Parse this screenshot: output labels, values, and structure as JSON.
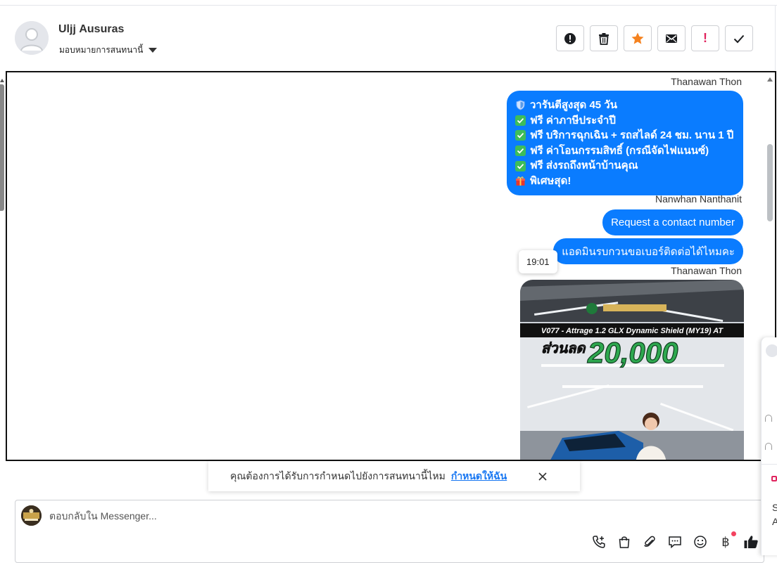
{
  "header": {
    "contact_name": "Ulјј Ausuras",
    "assign_label": "มอบหมายการสนทนานี้"
  },
  "chat": {
    "sender_1": "Thanawan Thon",
    "info_lines": [
      "วารันตีสูงสุด 45 วัน",
      "ฟรี ค่าภาษีประจำปี",
      "ฟรี บริการฉุกเฉิน + รถสไลด์ 24 ชม. นาน 1 ปี",
      "ฟรี ค่าโอนกรรมสิทธิ์ (กรณีจัดไฟแนนซ์)",
      "ฟรี ส่งรถถึงหน้าบ้านคุณ",
      "พิเศษสุด!"
    ],
    "sender_2": "Nanwhan Nanthanit",
    "msg_request": "Request a contact number",
    "msg_thai": "แอดมินรบกวนขอเบอร์ติดต่อได้ไหมคะ",
    "time_tooltip": "19:01",
    "sender_3": "Thanawan Thon",
    "video": {
      "model_text": "V077 - Attrage 1.2 GLX Dynamic Shield (MY19) AT",
      "discount_label": "ส่วนลด",
      "discount_value": "20,000"
    }
  },
  "assign_banner": {
    "question": "คุณต้องการได้รับการกำหนดไปยังการสนทนานี้ไหม",
    "action": "กำหนดให้ฉัน"
  },
  "composer": {
    "placeholder": "ตอบกลับใน Messenger..."
  },
  "side_panel": {
    "text_1": "S",
    "text_2": "A"
  },
  "icons": {
    "toolbar": [
      "alert-circle-icon",
      "trash-icon",
      "star-icon",
      "mail-icon",
      "exclamation-icon",
      "check-icon"
    ],
    "composer": [
      "phone-plus-icon",
      "shopping-bag-icon",
      "paperclip-icon",
      "chat-bubble-icon",
      "emoji-icon",
      "baht-icon",
      "thumbs-up-icon"
    ]
  },
  "colors": {
    "bubble": "#0a7cff",
    "star": "#f5821f",
    "link": "#1877f2",
    "alert": "#e0245e"
  }
}
